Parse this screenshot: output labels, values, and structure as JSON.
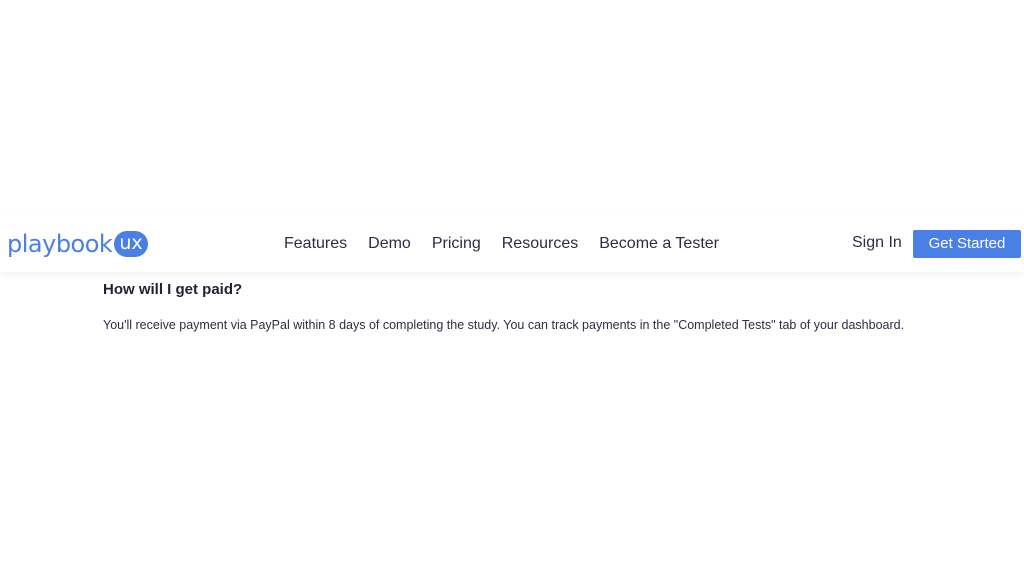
{
  "navbar": {
    "logo": {
      "text": "playbook",
      "badge": "ux"
    },
    "links": [
      "Features",
      "Demo",
      "Pricing",
      "Resources",
      "Become a Tester"
    ],
    "sign_in": "Sign In",
    "cta": "Get Started"
  },
  "faq": {
    "question": "How will I get paid?",
    "answer": "You'll receive payment via PayPal within 8 days of completing the study. You can track payments in the \"Completed Tests\" tab of your dashboard."
  },
  "colors": {
    "brand": "#4a7fe6",
    "text": "#2b2e45",
    "background": "#ffffff"
  }
}
